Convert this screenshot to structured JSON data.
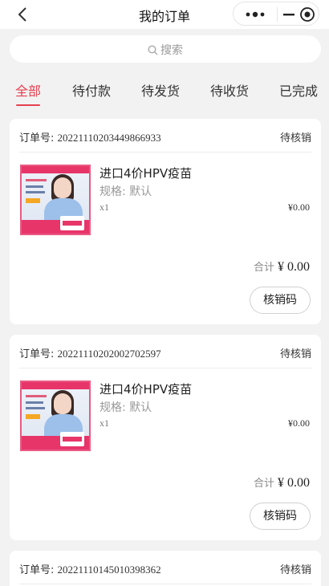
{
  "nav": {
    "title": "我的订单"
  },
  "search": {
    "placeholder": "搜索"
  },
  "tabs": [
    {
      "label": "全部"
    },
    {
      "label": "待付款"
    },
    {
      "label": "待发货"
    },
    {
      "label": "待收货"
    },
    {
      "label": "已完成"
    }
  ],
  "labels": {
    "order_no": "订单号:",
    "spec": "规格:",
    "total": "合计",
    "verify_button": "核销码"
  },
  "colors": {
    "accent": "#e5404f"
  },
  "orders": [
    {
      "order_no": "20221110203449866933",
      "status": "待核销",
      "product_name": "进口4价HPV疫苗",
      "spec": "默认",
      "qty": "x1",
      "price": "¥0.00",
      "total": "¥ 0.00"
    },
    {
      "order_no": "20221110202002702597",
      "status": "待核销",
      "product_name": "进口4价HPV疫苗",
      "spec": "默认",
      "qty": "x1",
      "price": "¥0.00",
      "total": "¥ 0.00"
    },
    {
      "order_no": "20221110145010398362",
      "status": "待核销"
    }
  ]
}
